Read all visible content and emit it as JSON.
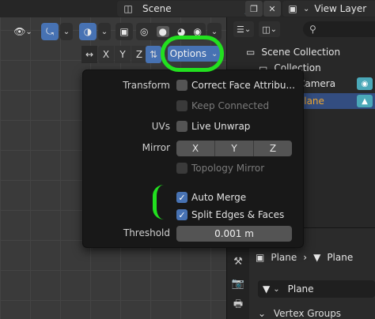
{
  "topbar": {
    "scene_name": "Scene",
    "view_layer": "View Layer"
  },
  "viewport_header": {
    "axis_buttons": [
      "X",
      "Y",
      "Z"
    ],
    "options_label": "Options"
  },
  "outliner": {
    "search_placeholder": "",
    "items": [
      {
        "label": "Scene Collection"
      },
      {
        "label": "Collection"
      },
      {
        "label": "Camera"
      },
      {
        "label": "Plane"
      }
    ]
  },
  "options_popover": {
    "transform_label": "Transform",
    "correct_face_attributes": "Correct Face Attribu...",
    "keep_connected": "Keep Connected",
    "uvs_label": "UVs",
    "live_unwrap": "Live Unwrap",
    "mirror_label": "Mirror",
    "mirror_axes": [
      "X",
      "Y",
      "Z"
    ],
    "topology_mirror": "Topology Mirror",
    "auto_merge": "Auto Merge",
    "split_edges_faces": "Split Edges & Faces",
    "threshold_label": "Threshold",
    "threshold_value": "0.001 m"
  },
  "properties": {
    "breadcrumb_object": "Plane",
    "breadcrumb_data": "Plane",
    "mesh_data_name": "Plane",
    "vertex_groups_label": "Vertex Groups"
  },
  "colors": {
    "accent_blue": "#4772b3",
    "annotation_green": "#22e01f",
    "selected_text": "#f0a830"
  }
}
